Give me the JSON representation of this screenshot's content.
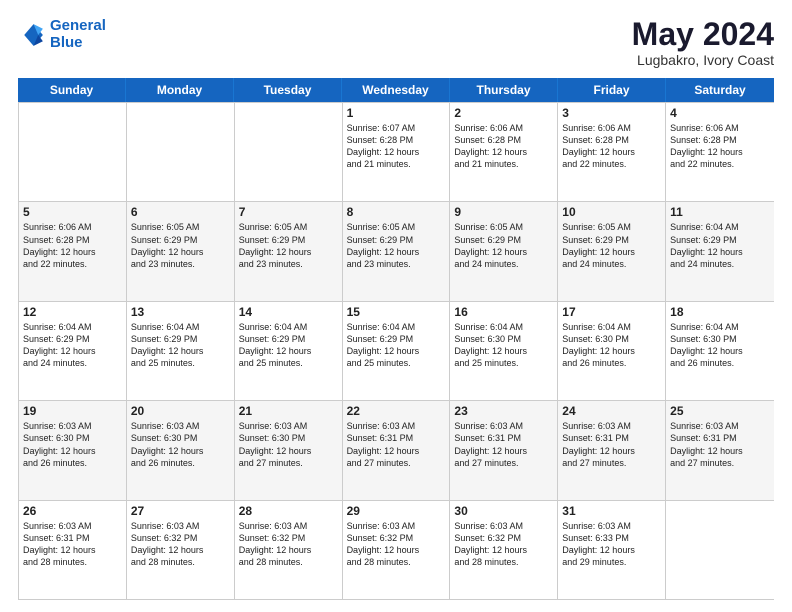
{
  "logo": {
    "line1": "General",
    "line2": "Blue"
  },
  "title": "May 2024",
  "subtitle": "Lugbakro, Ivory Coast",
  "days": [
    "Sunday",
    "Monday",
    "Tuesday",
    "Wednesday",
    "Thursday",
    "Friday",
    "Saturday"
  ],
  "weeks": [
    [
      {
        "day": "",
        "info": ""
      },
      {
        "day": "",
        "info": ""
      },
      {
        "day": "",
        "info": ""
      },
      {
        "day": "1",
        "info": "Sunrise: 6:07 AM\nSunset: 6:28 PM\nDaylight: 12 hours\nand 21 minutes."
      },
      {
        "day": "2",
        "info": "Sunrise: 6:06 AM\nSunset: 6:28 PM\nDaylight: 12 hours\nand 21 minutes."
      },
      {
        "day": "3",
        "info": "Sunrise: 6:06 AM\nSunset: 6:28 PM\nDaylight: 12 hours\nand 22 minutes."
      },
      {
        "day": "4",
        "info": "Sunrise: 6:06 AM\nSunset: 6:28 PM\nDaylight: 12 hours\nand 22 minutes."
      }
    ],
    [
      {
        "day": "5",
        "info": "Sunrise: 6:06 AM\nSunset: 6:28 PM\nDaylight: 12 hours\nand 22 minutes."
      },
      {
        "day": "6",
        "info": "Sunrise: 6:05 AM\nSunset: 6:29 PM\nDaylight: 12 hours\nand 23 minutes."
      },
      {
        "day": "7",
        "info": "Sunrise: 6:05 AM\nSunset: 6:29 PM\nDaylight: 12 hours\nand 23 minutes."
      },
      {
        "day": "8",
        "info": "Sunrise: 6:05 AM\nSunset: 6:29 PM\nDaylight: 12 hours\nand 23 minutes."
      },
      {
        "day": "9",
        "info": "Sunrise: 6:05 AM\nSunset: 6:29 PM\nDaylight: 12 hours\nand 24 minutes."
      },
      {
        "day": "10",
        "info": "Sunrise: 6:05 AM\nSunset: 6:29 PM\nDaylight: 12 hours\nand 24 minutes."
      },
      {
        "day": "11",
        "info": "Sunrise: 6:04 AM\nSunset: 6:29 PM\nDaylight: 12 hours\nand 24 minutes."
      }
    ],
    [
      {
        "day": "12",
        "info": "Sunrise: 6:04 AM\nSunset: 6:29 PM\nDaylight: 12 hours\nand 24 minutes."
      },
      {
        "day": "13",
        "info": "Sunrise: 6:04 AM\nSunset: 6:29 PM\nDaylight: 12 hours\nand 25 minutes."
      },
      {
        "day": "14",
        "info": "Sunrise: 6:04 AM\nSunset: 6:29 PM\nDaylight: 12 hours\nand 25 minutes."
      },
      {
        "day": "15",
        "info": "Sunrise: 6:04 AM\nSunset: 6:29 PM\nDaylight: 12 hours\nand 25 minutes."
      },
      {
        "day": "16",
        "info": "Sunrise: 6:04 AM\nSunset: 6:30 PM\nDaylight: 12 hours\nand 25 minutes."
      },
      {
        "day": "17",
        "info": "Sunrise: 6:04 AM\nSunset: 6:30 PM\nDaylight: 12 hours\nand 26 minutes."
      },
      {
        "day": "18",
        "info": "Sunrise: 6:04 AM\nSunset: 6:30 PM\nDaylight: 12 hours\nand 26 minutes."
      }
    ],
    [
      {
        "day": "19",
        "info": "Sunrise: 6:03 AM\nSunset: 6:30 PM\nDaylight: 12 hours\nand 26 minutes."
      },
      {
        "day": "20",
        "info": "Sunrise: 6:03 AM\nSunset: 6:30 PM\nDaylight: 12 hours\nand 26 minutes."
      },
      {
        "day": "21",
        "info": "Sunrise: 6:03 AM\nSunset: 6:30 PM\nDaylight: 12 hours\nand 27 minutes."
      },
      {
        "day": "22",
        "info": "Sunrise: 6:03 AM\nSunset: 6:31 PM\nDaylight: 12 hours\nand 27 minutes."
      },
      {
        "day": "23",
        "info": "Sunrise: 6:03 AM\nSunset: 6:31 PM\nDaylight: 12 hours\nand 27 minutes."
      },
      {
        "day": "24",
        "info": "Sunrise: 6:03 AM\nSunset: 6:31 PM\nDaylight: 12 hours\nand 27 minutes."
      },
      {
        "day": "25",
        "info": "Sunrise: 6:03 AM\nSunset: 6:31 PM\nDaylight: 12 hours\nand 27 minutes."
      }
    ],
    [
      {
        "day": "26",
        "info": "Sunrise: 6:03 AM\nSunset: 6:31 PM\nDaylight: 12 hours\nand 28 minutes."
      },
      {
        "day": "27",
        "info": "Sunrise: 6:03 AM\nSunset: 6:32 PM\nDaylight: 12 hours\nand 28 minutes."
      },
      {
        "day": "28",
        "info": "Sunrise: 6:03 AM\nSunset: 6:32 PM\nDaylight: 12 hours\nand 28 minutes."
      },
      {
        "day": "29",
        "info": "Sunrise: 6:03 AM\nSunset: 6:32 PM\nDaylight: 12 hours\nand 28 minutes."
      },
      {
        "day": "30",
        "info": "Sunrise: 6:03 AM\nSunset: 6:32 PM\nDaylight: 12 hours\nand 28 minutes."
      },
      {
        "day": "31",
        "info": "Sunrise: 6:03 AM\nSunset: 6:33 PM\nDaylight: 12 hours\nand 29 minutes."
      },
      {
        "day": "",
        "info": ""
      }
    ]
  ]
}
